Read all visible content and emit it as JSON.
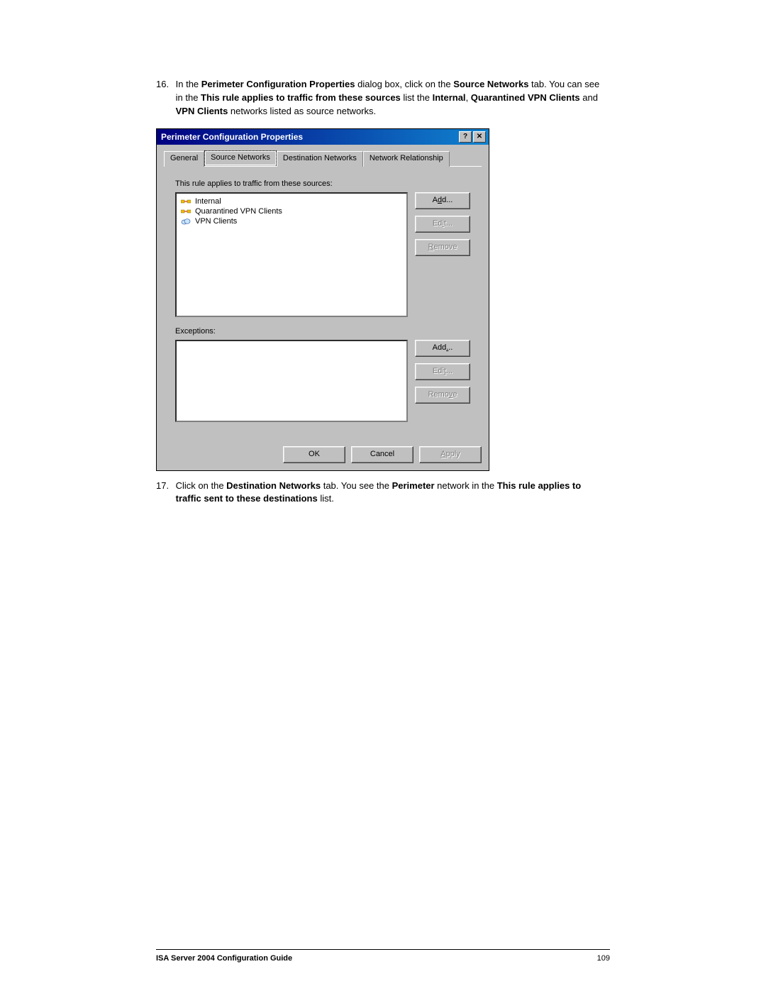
{
  "step16": {
    "num": "16.",
    "text_before": "In the ",
    "bold1": "Perimeter Configuration Properties",
    "text_mid1": " dialog box, click on the ",
    "bold2": "Source Networks",
    "text_mid2": " tab. You can see in the ",
    "bold3": "This rule applies to traffic from these sources",
    "text_mid3": " list the ",
    "bold4": "Internal",
    "text_mid4": ", ",
    "bold5": "Quarantined VPN Clients",
    "text_mid5": " and ",
    "bold6": "VPN Clients",
    "text_end": " networks listed as source networks."
  },
  "dialog": {
    "title": "Perimeter Configuration Properties",
    "help_btn": "?",
    "close_btn": "✕",
    "tabs": [
      "General",
      "Source Networks",
      "Destination Networks",
      "Network Relationship"
    ],
    "active_tab": 1,
    "sources_label": "This rule applies to traffic from these sources:",
    "sources": [
      {
        "icon": "net",
        "label": "Internal"
      },
      {
        "icon": "net",
        "label": "Quarantined VPN Clients"
      },
      {
        "icon": "cloud",
        "label": "VPN Clients"
      }
    ],
    "exceptions_label": "Exceptions:",
    "btn_add_pre": "A",
    "btn_add_u": "d",
    "btn_add_post": "d...",
    "btn_edit_pre": "Ed",
    "btn_edit_u": "i",
    "btn_edit_post": "t...",
    "btn_remove_pre": "",
    "btn_remove_u": "R",
    "btn_remove_post": "emove",
    "btn_add2_pre": "Add",
    "btn_add2_u": ".",
    "btn_add2_post": "..",
    "btn_edit2_pre": "Edi",
    "btn_edit2_u": "t",
    "btn_edit2_post": "...",
    "btn_remove2_pre": "Remo",
    "btn_remove2_u": "v",
    "btn_remove2_post": "e",
    "ok": "OK",
    "cancel": "Cancel",
    "apply_pre": "",
    "apply_u": "A",
    "apply_post": "pply"
  },
  "step17": {
    "num": "17.",
    "text_before": "Click on the ",
    "bold1": "Destination Networks",
    "text_mid1": " tab. You see the ",
    "bold2": "Perimeter",
    "text_mid2": " network in the ",
    "bold3": "This rule applies to traffic sent to these destinations",
    "text_end": " list."
  },
  "footer": {
    "title": "ISA Server 2004 Configuration Guide",
    "page": "109"
  }
}
